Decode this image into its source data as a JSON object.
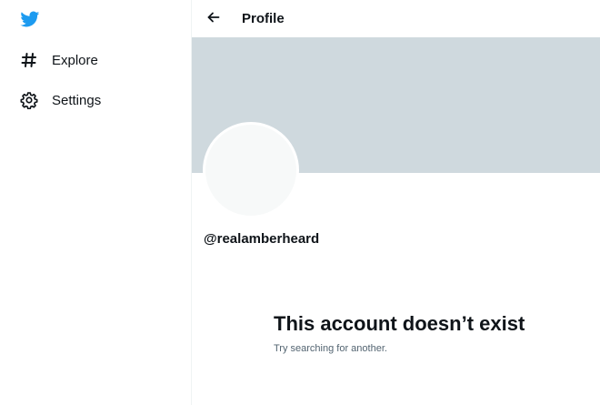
{
  "sidebar": {
    "logo_icon": "twitter-bird-icon",
    "items": [
      {
        "label": "Explore",
        "icon": "hashtag-icon"
      },
      {
        "label": "Settings",
        "icon": "gear-icon"
      }
    ]
  },
  "header": {
    "back_icon": "arrow-left-icon",
    "title": "Profile"
  },
  "profile": {
    "handle": "@realamberheard",
    "banner_color": "#cfd9de",
    "avatar_color": "#f7f9f9"
  },
  "empty_state": {
    "title": "This account doesn’t exist",
    "subtitle": "Try searching for another."
  },
  "colors": {
    "brand": "#1d9bf0",
    "text": "#0f1419",
    "muted": "#536471"
  }
}
